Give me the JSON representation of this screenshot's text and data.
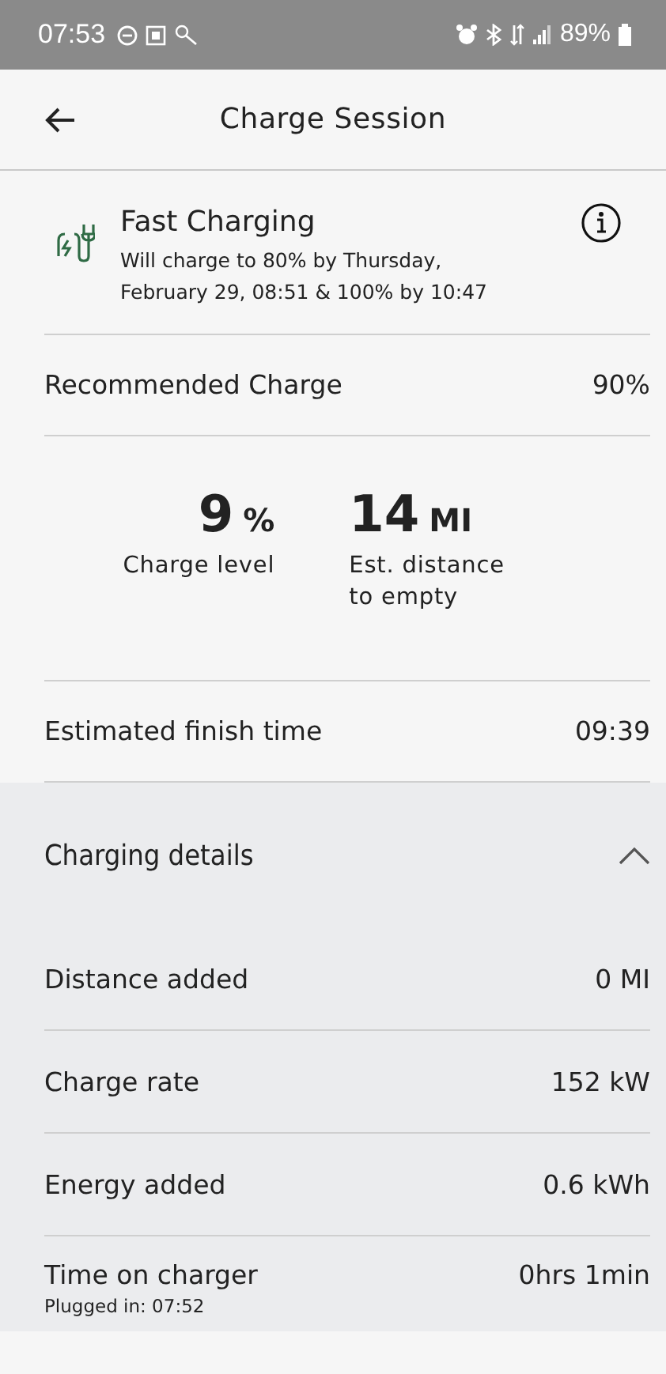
{
  "status_bar": {
    "time": "07:53",
    "battery": "89%"
  },
  "header": {
    "title": "Charge Session"
  },
  "notice": {
    "title": "Fast Charging",
    "text": "Will charge to 80% by Thursday, February 29, 08:51 & 100% by 10:47"
  },
  "recommended": {
    "label": "Recommended Charge",
    "value": "90%"
  },
  "stats": [
    {
      "value": "9",
      "unit": "%",
      "label": "Charge level"
    },
    {
      "value": "14",
      "unit": "MI",
      "label": "Est. distance to empty"
    }
  ],
  "finish": {
    "label": "Estimated finish time",
    "value": "09:39"
  },
  "details": {
    "title": "Charging details",
    "expanded": true,
    "rows": [
      {
        "label": "Distance added",
        "value": "0 MI"
      },
      {
        "label": "Charge rate",
        "value": "152 kW"
      },
      {
        "label": "Energy added",
        "value": "0.6 kWh"
      },
      {
        "label": "Time on charger",
        "value": "0hrs 1min",
        "note": "Plugged in: 07:52"
      }
    ]
  }
}
